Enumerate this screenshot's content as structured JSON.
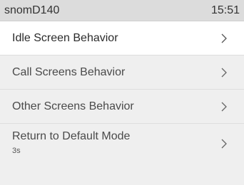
{
  "status": {
    "device_name": "snomD140",
    "time": "15:51"
  },
  "menu": {
    "items": [
      {
        "label": "Idle Screen Behavior"
      },
      {
        "label": "Call Screens Behavior"
      },
      {
        "label": "Other Screens Behavior"
      },
      {
        "label": "Return to Default Mode",
        "value": "3s"
      }
    ],
    "chevron_icon": "chevron-right-icon"
  },
  "colors": {
    "background": "#efefef",
    "statusbar": "#dcdcdc",
    "selected_row": "#ffffff"
  }
}
